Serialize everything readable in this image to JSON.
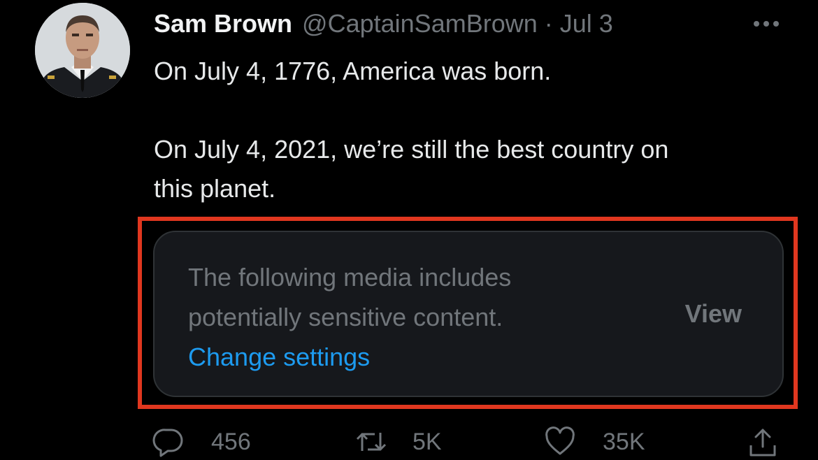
{
  "tweet": {
    "author_name": "Sam Brown",
    "handle": "@CaptainSamBrown",
    "separator": "·",
    "date": "Jul 3",
    "text_line_1": "On July 4, 1776, America was born.",
    "text_line_2": "On July 4, 2021, we’re still the best country on",
    "text_line_3": "this planet."
  },
  "media_warning": {
    "line_1": "The following media includes",
    "line_2": "potentially sensitive content.",
    "change_settings_link": "Change settings",
    "view_button": "View"
  },
  "actions": {
    "reply_count": "456",
    "retweet_count": "5K",
    "like_count": "35K"
  },
  "icons": [
    "more-icon",
    "reply-icon",
    "retweet-icon",
    "like-icon",
    "share-icon"
  ],
  "colors": {
    "background": "#000000",
    "link": "#1d9bf0",
    "secondary_text": "#71767b",
    "highlight_border": "#e0371f",
    "card_background": "#16181c"
  }
}
